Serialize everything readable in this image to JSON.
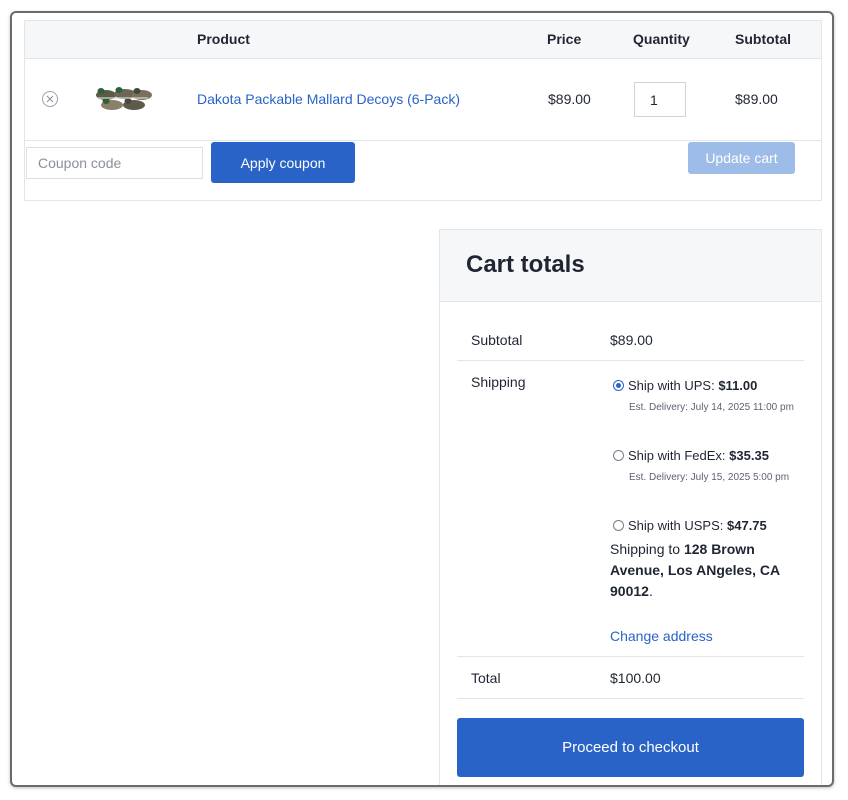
{
  "cart": {
    "headers": {
      "product": "Product",
      "price": "Price",
      "quantity": "Quantity",
      "subtotal": "Subtotal"
    },
    "items": [
      {
        "name": "Dakota Packable Mallard Decoys (6-Pack)",
        "price": "$89.00",
        "quantity": "1",
        "subtotal": "$89.00",
        "thumbnail_icon": "duck-decoys-thumbnail",
        "remove_icon": "remove-circle-x-icon"
      }
    ],
    "coupon": {
      "placeholder": "Coupon code",
      "value": ""
    },
    "apply_coupon_label": "Apply coupon",
    "update_cart_label": "Update cart"
  },
  "totals": {
    "title": "Cart totals",
    "subtotal_label": "Subtotal",
    "subtotal_value": "$89.00",
    "shipping_label": "Shipping",
    "shipping_options": [
      {
        "label": "Ship with UPS: ",
        "price": "$11.00",
        "est": "Est. Delivery: July 14, 2025 11:00 pm",
        "selected": true
      },
      {
        "label": "Ship with FedEx: ",
        "price": "$35.35",
        "est": "Est. Delivery: July 15, 2025 5:00 pm",
        "selected": false
      },
      {
        "label": "Ship with USPS: ",
        "price": "$47.75",
        "est": "",
        "selected": false
      }
    ],
    "shipping_to_prefix": "Shipping to ",
    "shipping_address": "128 Brown Avenue, Los ANgeles, CA 90012",
    "shipping_to_suffix": ".",
    "change_address_label": "Change address",
    "total_label": "Total",
    "total_value": "$100.00",
    "checkout_label": "Proceed to checkout"
  },
  "colors": {
    "accent": "#2a63c7",
    "disabled_button": "#9dbce8",
    "header_bg": "#f6f7f9"
  }
}
